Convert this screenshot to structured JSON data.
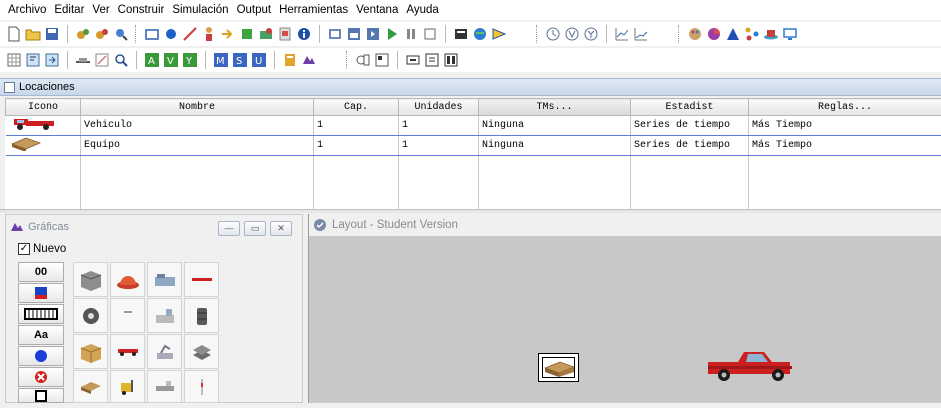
{
  "menu": [
    "Archivo",
    "Editar",
    "Ver",
    "Construir",
    "Simulación",
    "Output",
    "Herramientas",
    "Ventana",
    "Ayuda"
  ],
  "locations_panel": {
    "title": "Locaciones",
    "columns": [
      "Icono",
      "Nombre",
      "Cap.",
      "Unidades",
      "TMs...",
      "Estadist",
      "Reglas..."
    ],
    "rows": [
      {
        "icon": "red-truck-icon",
        "nombre": "Vehiculo",
        "cap": "1",
        "unidades": "1",
        "tms": "Ninguna",
        "estadist": "Series de tiempo",
        "reglas": "Más Tiempo"
      },
      {
        "icon": "pallet-icon",
        "nombre": "Equipo",
        "cap": "1",
        "unidades": "1",
        "tms": "Ninguna",
        "estadist": "Series de tiempo",
        "reglas": "Más Tiempo"
      }
    ]
  },
  "graphics_panel": {
    "title": "Gráficas",
    "new_label": "Nuevo",
    "new_checked": true,
    "counter_label": "00",
    "text_label": "Aa"
  },
  "layout_window": {
    "title": "Layout - Student Version"
  },
  "colors": {
    "row_border": "#5d7fd3",
    "panel_header": "#c7d6ea",
    "layout_bg": "#c8c8c8",
    "truck_red": "#cc1f1f"
  }
}
